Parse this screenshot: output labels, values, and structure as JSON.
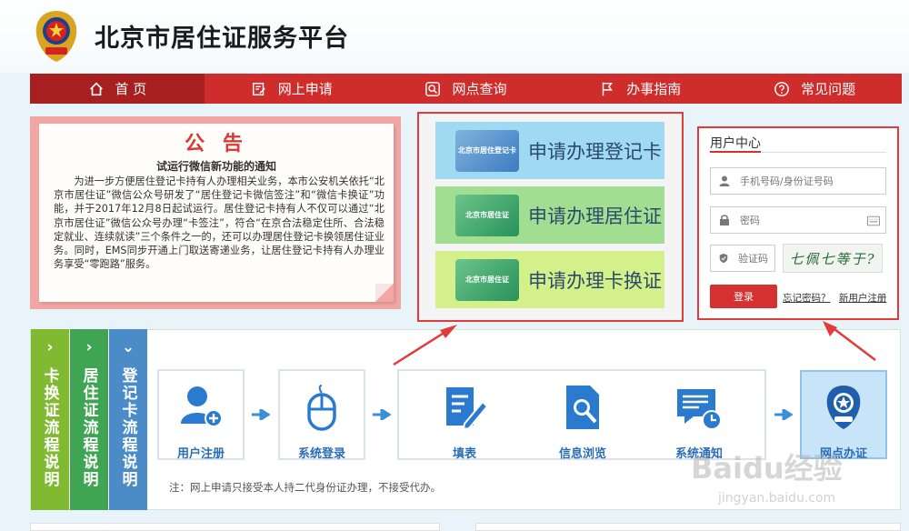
{
  "header": {
    "title": "北京市居住证服务平台"
  },
  "nav": [
    {
      "label": "首 页",
      "icon": "home-icon",
      "active": true
    },
    {
      "label": "网上申请",
      "icon": "edit-form-icon"
    },
    {
      "label": "网点查询",
      "icon": "search-icon"
    },
    {
      "label": "办事指南",
      "icon": "flag-icon"
    },
    {
      "label": "常见问题",
      "icon": "question-icon"
    }
  ],
  "notice": {
    "title": "公 告",
    "subtitle": "试运行微信新功能的通知",
    "body": "为进一步方便居住登记卡持有人办理相关业务，本市公安机关依托“北京市居住证”微信公众号研发了“居住登记卡微信签注”和“微信卡换证”功能，并于2017年12月8日起试运行。居住登记卡持有人不仅可以通过“北京市居住证”微信公众号办理“卡签注”，符合“在京合法稳定住所、合法稳定就业、连续就读”三个条件之一的，还可以办理居住登记卡换领居住证业务。同时，EMS同步开通上门取送寄递业务，让居住登记卡持有人办理业务享受“零跑路”服务。"
  },
  "cards": [
    {
      "label": "申请办理登记卡",
      "thumb": "北京市居住登记卡"
    },
    {
      "label": "申请办理居住证",
      "thumb": "北京市居住证"
    },
    {
      "label": "申请办理卡换证",
      "thumb": "北京市居住证"
    }
  ],
  "user_center": {
    "title": "用户中心",
    "username_placeholder": "手机号码/身份证号码",
    "password_placeholder": "密码",
    "captcha_placeholder": "验证码",
    "captcha_text": "七佩七等于?",
    "login_label": "登录",
    "forgot_label": "忘记密码？",
    "register_label": "新用户注册"
  },
  "process": {
    "tabs": [
      {
        "chev": "›",
        "label": "卡换证流程说明",
        "color": "#81b930"
      },
      {
        "chev": "›",
        "label": "居住证流程说明",
        "color": "#3fa553"
      },
      {
        "chev": "⌄",
        "label": "登记卡流程说明",
        "color": "#4b8cc8"
      }
    ],
    "steps": [
      {
        "label": "用户注册",
        "icon": "user-add-icon"
      },
      {
        "label": "系统登录",
        "icon": "mouse-icon"
      },
      {
        "label": "填表",
        "icon": "form-edit-icon"
      },
      {
        "label": "信息浏览",
        "icon": "document-search-icon"
      },
      {
        "label": "系统通知",
        "icon": "notification-clock-icon"
      },
      {
        "label": "网点办证",
        "icon": "police-emblem-icon"
      }
    ],
    "note": "注：网上申请只接受本人持二代身份证办理，不接受代办。"
  },
  "watermark": {
    "brand": "Baidu经验",
    "url": "jingyan.baidu.com"
  },
  "colors": {
    "nav_red": "#cf2c2c",
    "highlight_red": "#e33a3a",
    "step_blue": "#2a6db5"
  }
}
